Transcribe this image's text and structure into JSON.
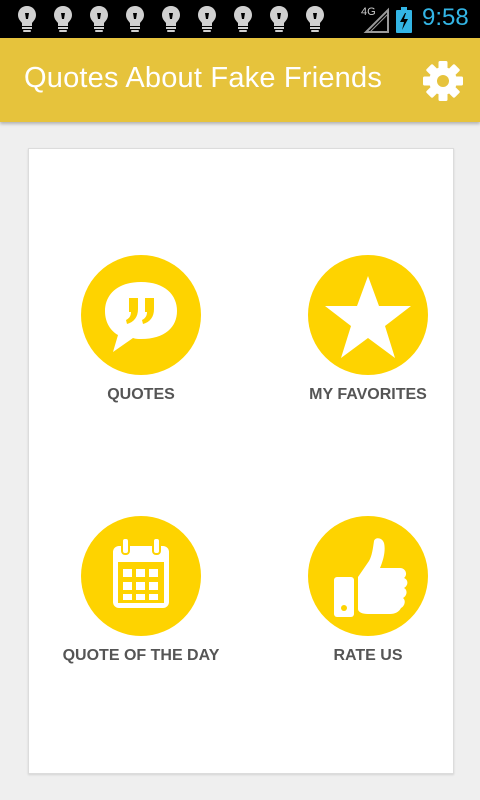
{
  "status_bar": {
    "notification_icons": [
      "lightbulb-icon",
      "lightbulb-icon",
      "lightbulb-icon",
      "lightbulb-icon",
      "lightbulb-icon",
      "lightbulb-icon",
      "lightbulb-icon",
      "lightbulb-icon",
      "lightbulb-icon"
    ],
    "network": "4G",
    "time": "9:58",
    "time_color": "#33b5e5"
  },
  "app_bar": {
    "title": "Quotes About Fake Friends",
    "background": "#e6c33c",
    "settings_icon": "gear-icon"
  },
  "menu": {
    "accent": "#fed300",
    "items": [
      {
        "label": "QUOTES",
        "icon": "speech-bubble-quote-icon"
      },
      {
        "label": "MY FAVORITES",
        "icon": "star-icon"
      },
      {
        "label": "QUOTE OF THE DAY",
        "icon": "calendar-icon"
      },
      {
        "label": "RATE US",
        "icon": "thumbs-up-icon"
      }
    ]
  }
}
